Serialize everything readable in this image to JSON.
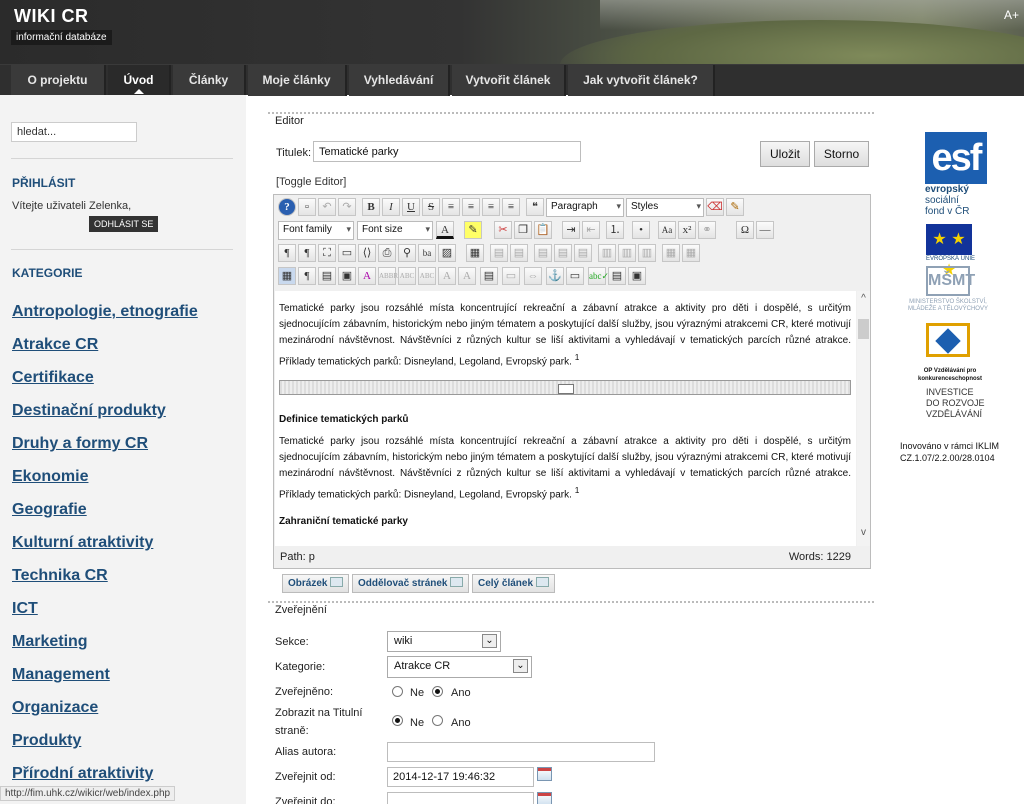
{
  "header": {
    "title": "WIKI CR",
    "subtitle": "informační databáze",
    "font_size_icon": "A+"
  },
  "nav": {
    "items": [
      {
        "label": "O projektu"
      },
      {
        "label": "Úvod"
      },
      {
        "label": "Články"
      },
      {
        "label": "Moje články"
      },
      {
        "label": "Vyhledávání"
      },
      {
        "label": "Vytvořit článek"
      },
      {
        "label": "Jak vytvořit článek?"
      }
    ],
    "active": "Úvod"
  },
  "sidebar": {
    "search_value": "hledat...",
    "login_title": "PŘIHLÁSIT",
    "welcome": "Vítejte uživateli Zelenka,",
    "logout_label": "ODHLÁSIT SE",
    "categories_title": "KATEGORIE",
    "categories": [
      "Antropologie, etnografie",
      "Atrakce CR",
      "Certifikace",
      "Destinační produkty",
      "Druhy a formy CR",
      "Ekonomie",
      "Geografie",
      "Kulturní atraktivity",
      "Technika CR",
      "ICT",
      "Marketing",
      "Management",
      "Organizace",
      "Produkty",
      "Přírodní atraktivity"
    ],
    "status_url": "http://fim.uhk.cz/wikicr/web/index.php"
  },
  "editor": {
    "section_title": "Editor",
    "title_label": "Titulek:",
    "title_value": "Tematické parky",
    "save_label": "Uložit",
    "cancel_label": "Storno",
    "toggle_label": "[Toggle Editor]",
    "toolbar": {
      "format_select": "Paragraph",
      "styles_select": "Styles",
      "font_family": "Font family",
      "font_size": "Font size"
    },
    "content": {
      "intro": "Tematické parky jsou rozsáhlé místa koncentrující rekreační a zábavní atrakce a aktivity pro děti i dospělé, s určitým sjednocujícím zábavním, historickým nebo jiným tématem a poskytující další služby, jsou výraznými atrakcemi CR, které motivují mezinárodní návštěvnost. Návštěvníci z různých kultur se liší aktivitami a vyhledávají v tematických parcích různé atrakce. Příklady tematických parků: Disneyland, Legoland, Evropský park.",
      "footnote": "1",
      "heading1": "Definice tematických parků",
      "para2": "Tematické parky jsou rozsáhlé místa koncentrující rekreační a zábavní atrakce a aktivity pro děti i dospělé, s určitým sjednocujícím zábavním, historickým nebo jiným tématem a poskytující další služby, jsou výraznými atrakcemi CR, které motivují mezinárodní návštěvnost. Návštěvníci z různých kultur se liší aktivitami a vyhledávají v tematických parcích různé atrakce. Příklady tematických parků: Disneyland, Legoland, Evropský park.",
      "heading2": "Zahraniční tematické parky"
    },
    "path_label": "Path:",
    "path_value": "p",
    "words_label": "Words:",
    "words_value": "1229",
    "buttons": [
      "Obrázek",
      "Oddělovač stránek",
      "Celý článek"
    ]
  },
  "publish": {
    "section_title": "Zveřejnění",
    "sekce_label": "Sekce:",
    "sekce_value": "wiki",
    "kategorie_label": "Kategorie:",
    "kategorie_value": "Atrakce CR",
    "zverejneno_label": "Zveřejněno:",
    "zobrazit_label_1": "Zobrazit na Titulní",
    "zobrazit_label_2": "straně:",
    "radio_no": "Ne",
    "radio_yes": "Ano",
    "zverejneno_selected": "Ano",
    "zobrazit_selected": "Ne",
    "alias_label": "Alias autora:",
    "alias_value": "",
    "from_label": "Zveřejnit od:",
    "from_value": "2014-12-17 19:46:32",
    "to_label": "Zveřejnit do:",
    "to_value": ""
  },
  "logos": {
    "esf_word": "esf",
    "esf_lines": [
      "evropský",
      "sociální",
      "fond v ČR"
    ],
    "eu_caption": "EVROPSKÁ UNIE",
    "msmt_text": "MŠMT",
    "msmt_caption": "MINISTERSTVO ŠKOLSTVÍ, MLÁDEŽE A TĚLOVÝCHOVY",
    "op_caption": "OP Vzdělávání pro konkurenceschopnost",
    "invest_lines": [
      "INVESTICE",
      "DO ROZVOJE",
      "VZDĚLÁVÁNÍ"
    ],
    "innov_lines": [
      "Inovováno v rámci IKLIM",
      "CZ.1.07/2.2.00/28.0104"
    ]
  }
}
